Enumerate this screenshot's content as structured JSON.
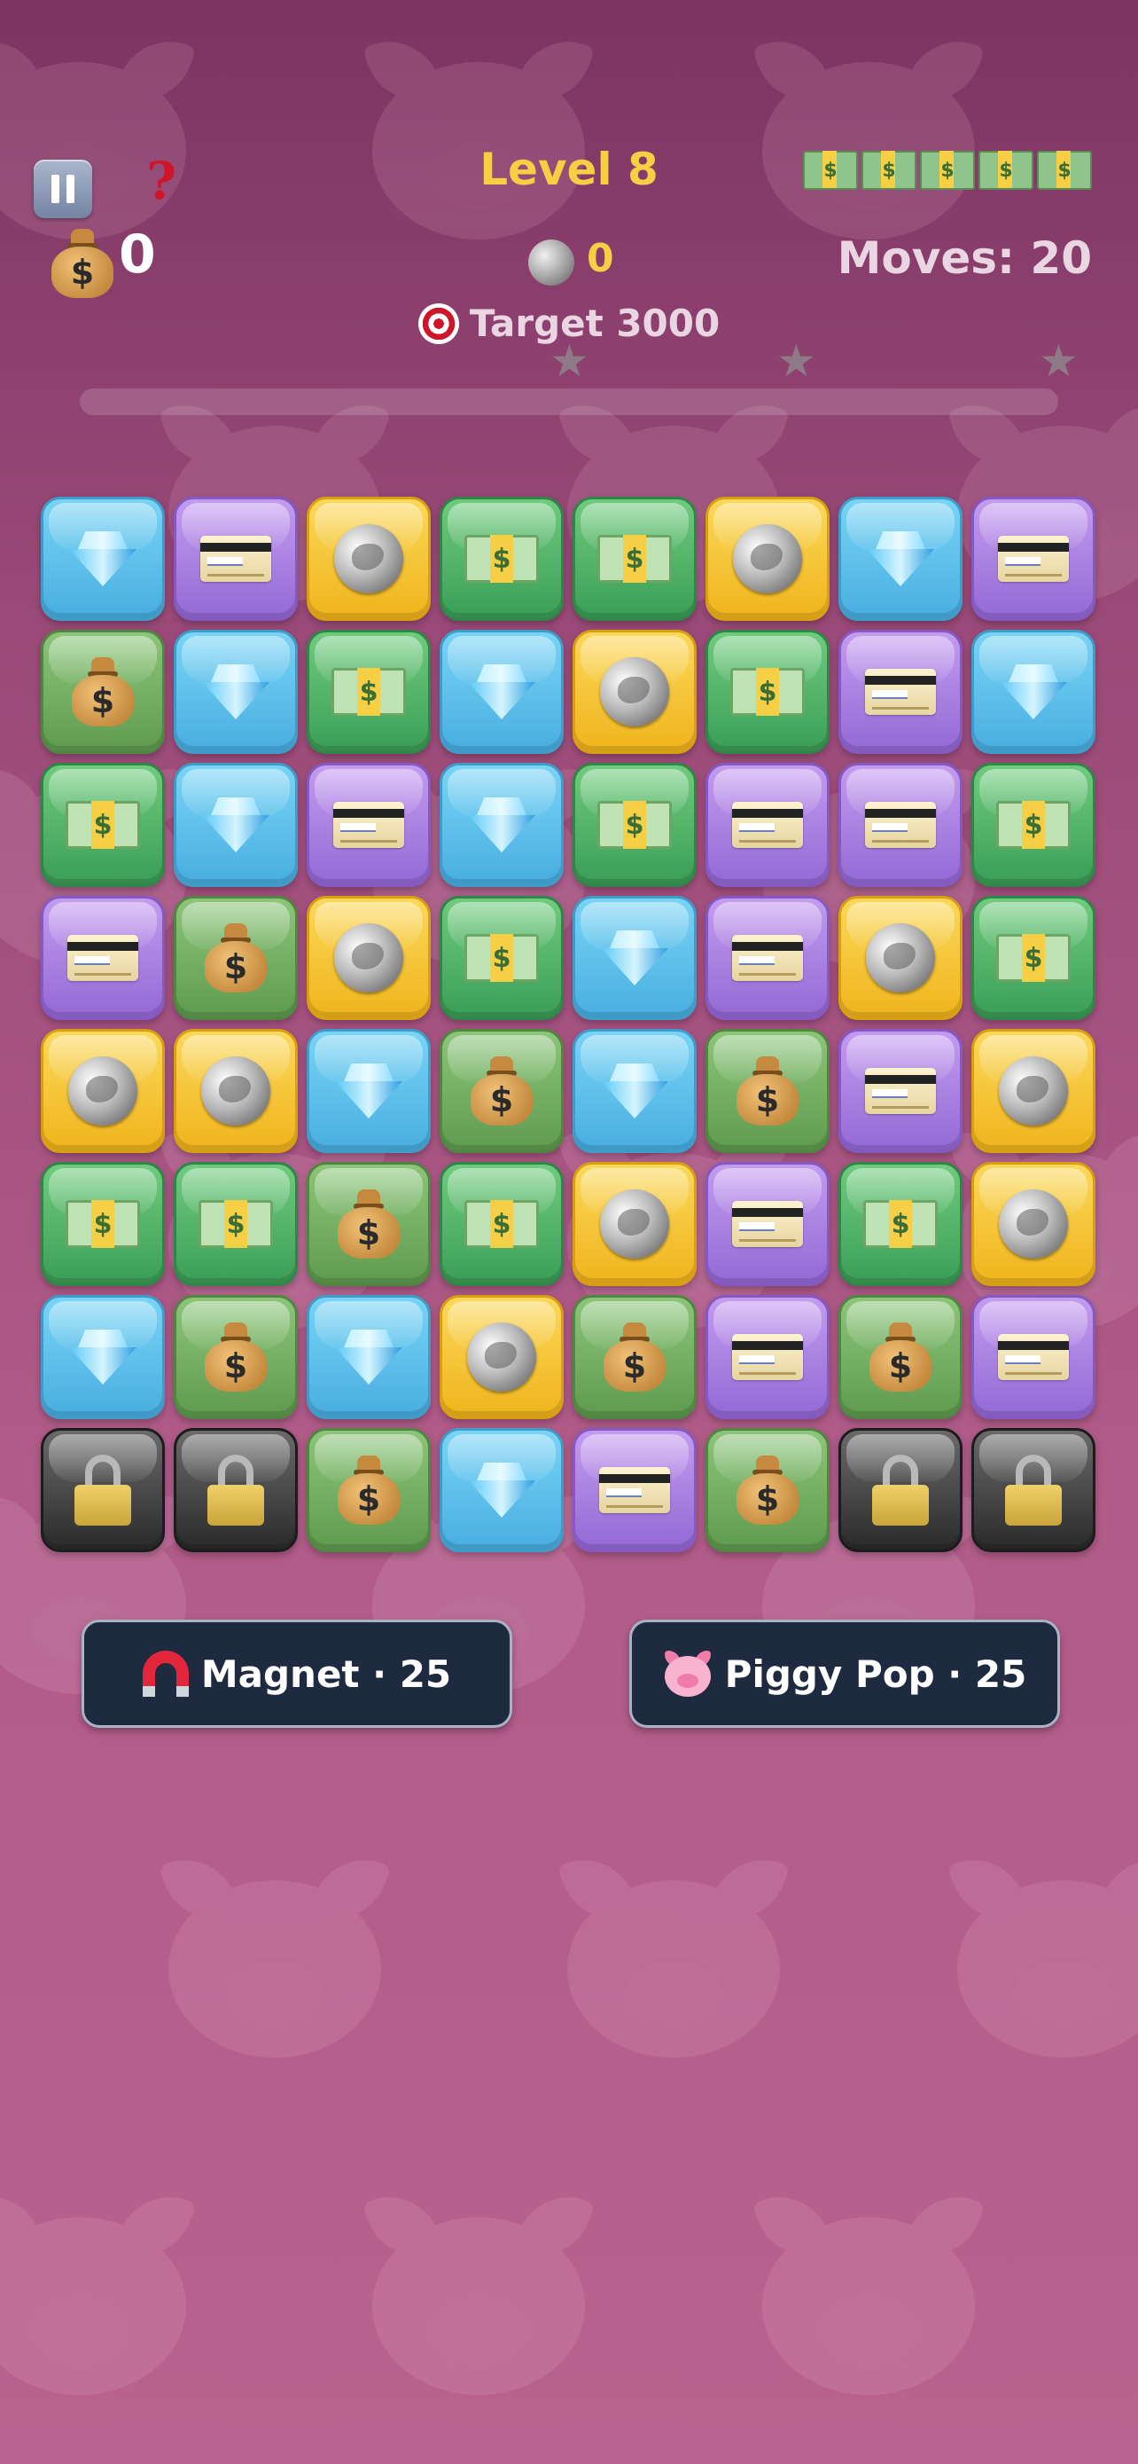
{
  "header": {
    "level_title": "Level 8",
    "coins_value": "0",
    "silver_value": "0",
    "moves_text": "Moves: 20",
    "target_text": "Target 3000",
    "help_symbol": "?",
    "cash_icon_count": 5,
    "progress_fraction": 0
  },
  "icons": {
    "pause": "pause-icon",
    "help": "question-mark-icon",
    "coins": "money-bag-icon",
    "silver": "silver-coin-icon",
    "target": "target-icon",
    "cash": "banknote-icon",
    "star": "star-icon"
  },
  "tile_types": {
    "D": "diamond",
    "C": "credit-card",
    "S": "silver-coin",
    "$": "banknote",
    "B": "money-bag",
    "L": "padlock"
  },
  "board": [
    [
      "D",
      "C",
      "S",
      "$",
      "$",
      "S",
      "D",
      "C"
    ],
    [
      "B",
      "D",
      "$",
      "D",
      "S",
      "$",
      "C",
      "D"
    ],
    [
      "$",
      "D",
      "C",
      "D",
      "$",
      "C",
      "C",
      "$"
    ],
    [
      "C",
      "B",
      "S",
      "$",
      "D",
      "C",
      "S",
      "$"
    ],
    [
      "S",
      "S",
      "D",
      "B",
      "D",
      "B",
      "C",
      "S"
    ],
    [
      "$",
      "$",
      "B",
      "$",
      "S",
      "C",
      "$",
      "S"
    ],
    [
      "D",
      "B",
      "D",
      "S",
      "B",
      "C",
      "B",
      "C"
    ],
    [
      "L",
      "L",
      "B",
      "D",
      "C",
      "B",
      "L",
      "L"
    ]
  ],
  "powerups": {
    "magnet_label": "Magnet · 25",
    "piggy_label": "Piggy Pop · 25"
  },
  "colors": {
    "background_top": "#7d3461",
    "background_bottom": "#b8628f",
    "level_title": "#f6cf45",
    "button_bg": "#1d2a3f"
  }
}
